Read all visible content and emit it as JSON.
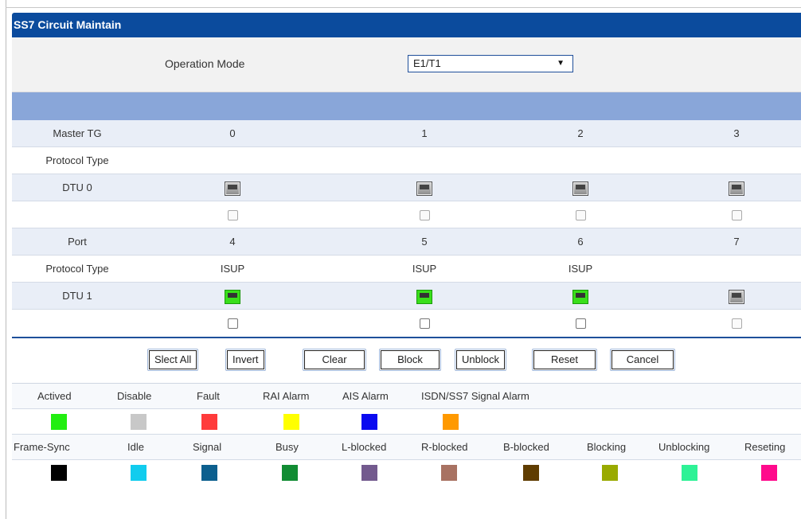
{
  "title": "SS7 Circuit Maintain",
  "operation_mode": {
    "label": "Operation Mode",
    "value": "E1/T1"
  },
  "header_row": {
    "label": "Master TG",
    "columns": [
      "0",
      "1",
      "2",
      "3"
    ]
  },
  "dtu0": {
    "protocol_label": "Protocol Type",
    "protocols": [
      "",
      "",
      "",
      ""
    ],
    "label": "DTU 0",
    "ports_active": [
      false,
      false,
      false,
      false
    ],
    "checkboxes_enabled": [
      false,
      false,
      false,
      false
    ]
  },
  "port_row": {
    "label": "Port",
    "columns": [
      "4",
      "5",
      "6",
      "7"
    ]
  },
  "dtu1": {
    "protocol_label": "Protocol Type",
    "protocols": [
      "ISUP",
      "ISUP",
      "ISUP",
      ""
    ],
    "label": "DTU 1",
    "ports_active": [
      true,
      true,
      true,
      false
    ],
    "checkboxes_enabled": [
      true,
      true,
      true,
      false
    ]
  },
  "buttons": {
    "select_all": "Slect All",
    "invert": "Invert",
    "clear": "Clear",
    "block": "Block",
    "unblock": "Unblock",
    "reset": "Reset",
    "cancel": "Cancel"
  },
  "legend_alarm": [
    {
      "label": "Actived",
      "color": "#22ee11"
    },
    {
      "label": "Disable",
      "color": "#c8c8c8"
    },
    {
      "label": "Fault",
      "color": "#ff3b3b"
    },
    {
      "label": "RAI Alarm",
      "color": "#ffff00"
    },
    {
      "label": "AIS Alarm",
      "color": "#0a0af0"
    },
    {
      "label": "ISDN/SS7 Signal Alarm",
      "color": "#ff9900"
    }
  ],
  "legend_state": [
    {
      "label": "Frame-Sync",
      "color": "#000000"
    },
    {
      "label": "Idle",
      "color": "#11ccee"
    },
    {
      "label": "Signal",
      "color": "#0c5f8e"
    },
    {
      "label": "Busy",
      "color": "#118c33"
    },
    {
      "label": "L-blocked",
      "color": "#735a8e"
    },
    {
      "label": "R-blocked",
      "color": "#a87262"
    },
    {
      "label": "B-blocked",
      "color": "#5f3c00"
    },
    {
      "label": "Blocking",
      "color": "#99aa00"
    },
    {
      "label": "Unblocking",
      "color": "#2ef296"
    },
    {
      "label": "Reseting",
      "color": "#ff0a8c"
    }
  ]
}
